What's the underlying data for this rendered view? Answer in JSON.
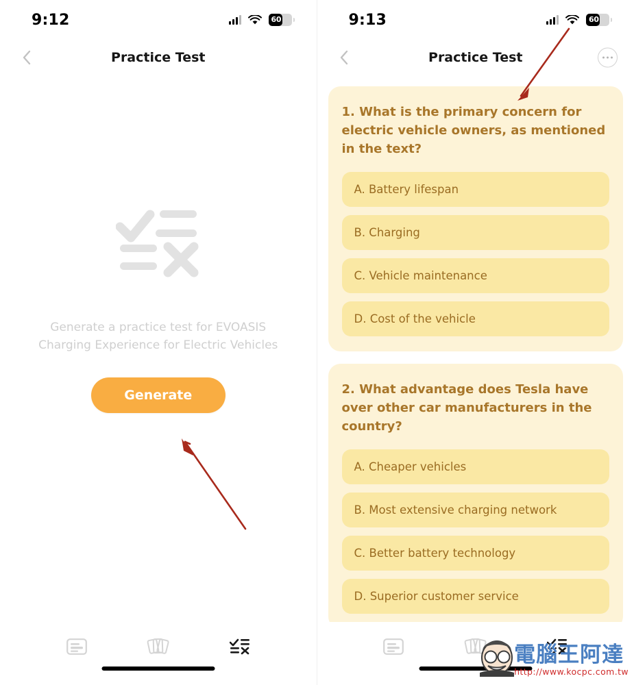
{
  "app": {
    "accent_orange": "#f9ad42",
    "card_bg": "#fdf3d7",
    "option_bg": "#fae8a4",
    "question_text_color": "#a8762a",
    "annotation_color": "#a82a1c"
  },
  "left_screen": {
    "status_bar": {
      "time": "9:12",
      "battery_percent": "60",
      "signal_icon": "cellular-signal-icon",
      "wifi_icon": "wifi-icon",
      "battery_icon": "battery-icon"
    },
    "nav": {
      "back_icon": "chevron-left-icon",
      "title": "Practice Test"
    },
    "empty_state": {
      "illustration_icon": "checklist-quiz-icon",
      "description": "Generate a practice test for EVOASIS Charging Experience for Electric Vehicles",
      "button_label": "Generate"
    },
    "tab_bar": {
      "items": [
        {
          "icon": "summary-card-icon",
          "name": "summary",
          "active": false
        },
        {
          "icon": "flashcards-icon",
          "name": "flashcards",
          "active": false
        },
        {
          "icon": "practice-test-icon",
          "name": "practice-test",
          "active": true
        }
      ]
    }
  },
  "right_screen": {
    "status_bar": {
      "time": "9:13",
      "battery_percent": "60",
      "signal_icon": "cellular-signal-icon",
      "wifi_icon": "wifi-icon",
      "battery_icon": "battery-icon"
    },
    "nav": {
      "back_icon": "chevron-left-icon",
      "title": "Practice Test",
      "more_icon": "more-options-icon"
    },
    "questions": [
      {
        "text": "1. What is the primary concern for electric vehicle owners, as mentioned in the text?",
        "options": [
          "A. Battery lifespan",
          "B. Charging",
          "C. Vehicle maintenance",
          "D. Cost of the vehicle"
        ]
      },
      {
        "text": "2. What advantage does Tesla have over other car manufacturers in the country?",
        "options": [
          "A. Cheaper vehicles",
          "B. Most extensive charging network",
          "C. Better battery technology",
          "D. Superior customer service"
        ]
      }
    ],
    "tab_bar": {
      "items": [
        {
          "icon": "summary-card-icon",
          "name": "summary",
          "active": false
        },
        {
          "icon": "flashcards-icon",
          "name": "flashcards",
          "active": false
        },
        {
          "icon": "practice-test-icon",
          "name": "practice-test",
          "active": true
        }
      ]
    }
  },
  "annotations": [
    {
      "name": "arrow-to-generate-button",
      "color": "#a82a1c"
    },
    {
      "name": "arrow-to-question-one",
      "color": "#a82a1c"
    }
  ],
  "watermark": {
    "site_name": "電腦王阿達",
    "url": "http://www.kocpc.com.tw",
    "face_icon": "mascot-face-icon"
  }
}
